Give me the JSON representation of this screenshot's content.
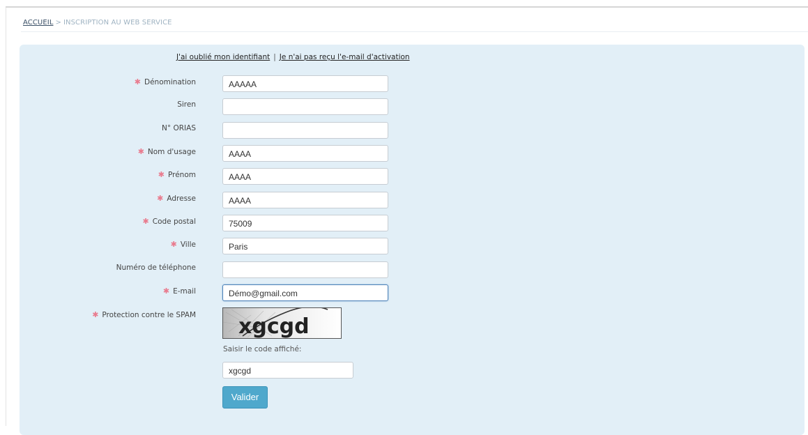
{
  "breadcrumb": {
    "home": "ACCUEIL",
    "separator": ">",
    "current": "INSCRIPTION AU WEB SERVICE"
  },
  "links": {
    "forgot_id": "J'ai oublié mon identifiant",
    "separator": "|",
    "no_activation_email": "Je n'ai pas reçu l'e-mail d'activation"
  },
  "form": {
    "required_marker": "✱",
    "fields": [
      {
        "label": "Dénomination",
        "required": true,
        "value": "AAAAA"
      },
      {
        "label": "Siren",
        "required": false,
        "value": ""
      },
      {
        "label": "N° ORIAS",
        "required": false,
        "value": ""
      },
      {
        "label": "Nom d'usage",
        "required": true,
        "value": "AAAA"
      },
      {
        "label": "Prénom",
        "required": true,
        "value": "AAAA"
      },
      {
        "label": "Adresse",
        "required": true,
        "value": "AAAA"
      },
      {
        "label": "Code postal",
        "required": true,
        "value": "75009"
      },
      {
        "label": "Ville",
        "required": true,
        "value": "Paris"
      },
      {
        "label": "Numéro de téléphone",
        "required": false,
        "value": ""
      },
      {
        "label": "E-mail",
        "required": true,
        "value": "Démo@gmail.com"
      }
    ],
    "captcha": {
      "label": "Protection contre le SPAM",
      "image_text": "xgcgd",
      "prompt": "Saisir le code affiché:",
      "value": "xgcgd"
    },
    "submit_label": "Valider"
  },
  "colors": {
    "panel_bg": "#e2eff7",
    "required": "#e97b8e",
    "button": "#4fa8cc",
    "focus_border": "#4e83b9"
  }
}
